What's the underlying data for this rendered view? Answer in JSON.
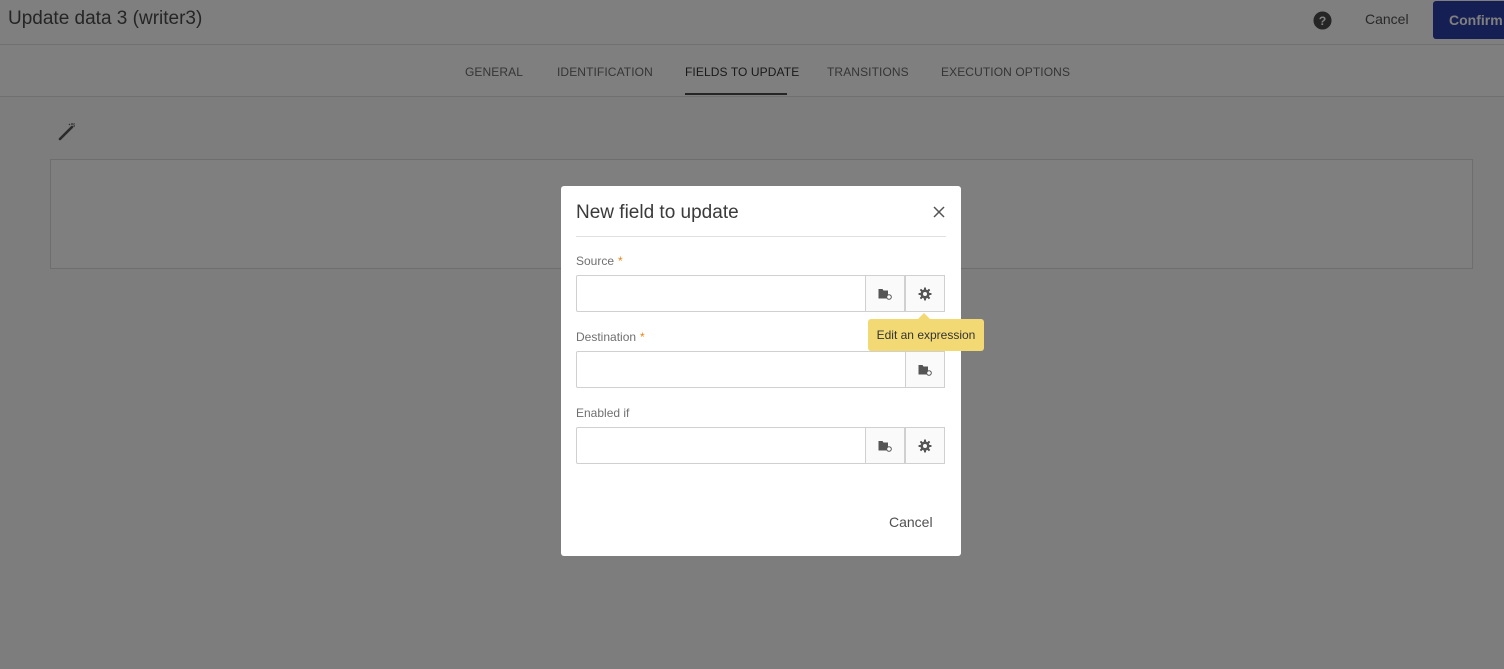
{
  "header": {
    "title": "Update data 3 (writer3)",
    "cancel_label": "Cancel",
    "confirm_label": "Confirm"
  },
  "tabs": [
    {
      "label": "GENERAL",
      "active": false
    },
    {
      "label": "IDENTIFICATION",
      "active": false
    },
    {
      "label": "FIELDS TO UPDATE",
      "active": true
    },
    {
      "label": "TRANSITIONS",
      "active": false
    },
    {
      "label": "EXECUTION OPTIONS",
      "active": false
    }
  ],
  "dialog": {
    "title": "New field to update",
    "fields": {
      "source": {
        "label": "Source",
        "required_mark": "*",
        "value": ""
      },
      "destination": {
        "label": "Destination",
        "required_mark": "*",
        "value": ""
      },
      "enabled_if": {
        "label": "Enabled if",
        "value": ""
      }
    },
    "cancel_label": "Cancel"
  },
  "tooltip": {
    "text": "Edit an expression"
  },
  "colors": {
    "confirm_button": "#2c3fa6",
    "required_mark": "#e68619",
    "tooltip_bg": "#f2d974",
    "overlay": "rgba(0,0,0,0.5)"
  },
  "icons": {
    "help": "help-circle-icon",
    "wand": "magic-wand-icon",
    "close": "close-icon",
    "folder": "folder-browse-icon",
    "gear": "gear-icon"
  }
}
